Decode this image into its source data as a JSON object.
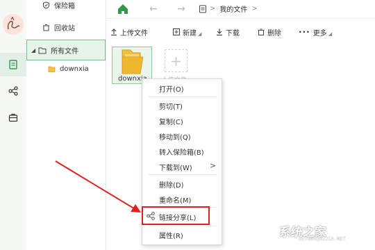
{
  "sidebar_tree": {
    "vault": "保险箱",
    "recycle": "回收站",
    "all_files": "所有文件",
    "child": "downxia"
  },
  "nav": {
    "breadcrumb": "我的文件",
    "breadcrumb_chevron": ">"
  },
  "toolbar": {
    "upload": "上传文件",
    "new": "新建",
    "download": "下载",
    "delete": "删除",
    "more": "更多"
  },
  "files": [
    {
      "name": "downxia",
      "type": "folder"
    }
  ],
  "upload_tile_label": "上传文件",
  "context_menu": {
    "items": [
      "打开(O)",
      "剪切(T)",
      "复制(C)",
      "移动到(Q)",
      "转入保险箱(B)",
      "下载到(W)",
      "删除(D)",
      "重命名(M)",
      "链接分享(L)",
      "属性(R)"
    ],
    "submenu_indicator": ">"
  },
  "watermark": {
    "text": "系统之家",
    "sub": "XITONGZHIJIA.NET"
  },
  "colors": {
    "accent_green": "#2e9a4a",
    "highlight_red": "#e02020",
    "selection_bg": "#e6f3e9"
  }
}
